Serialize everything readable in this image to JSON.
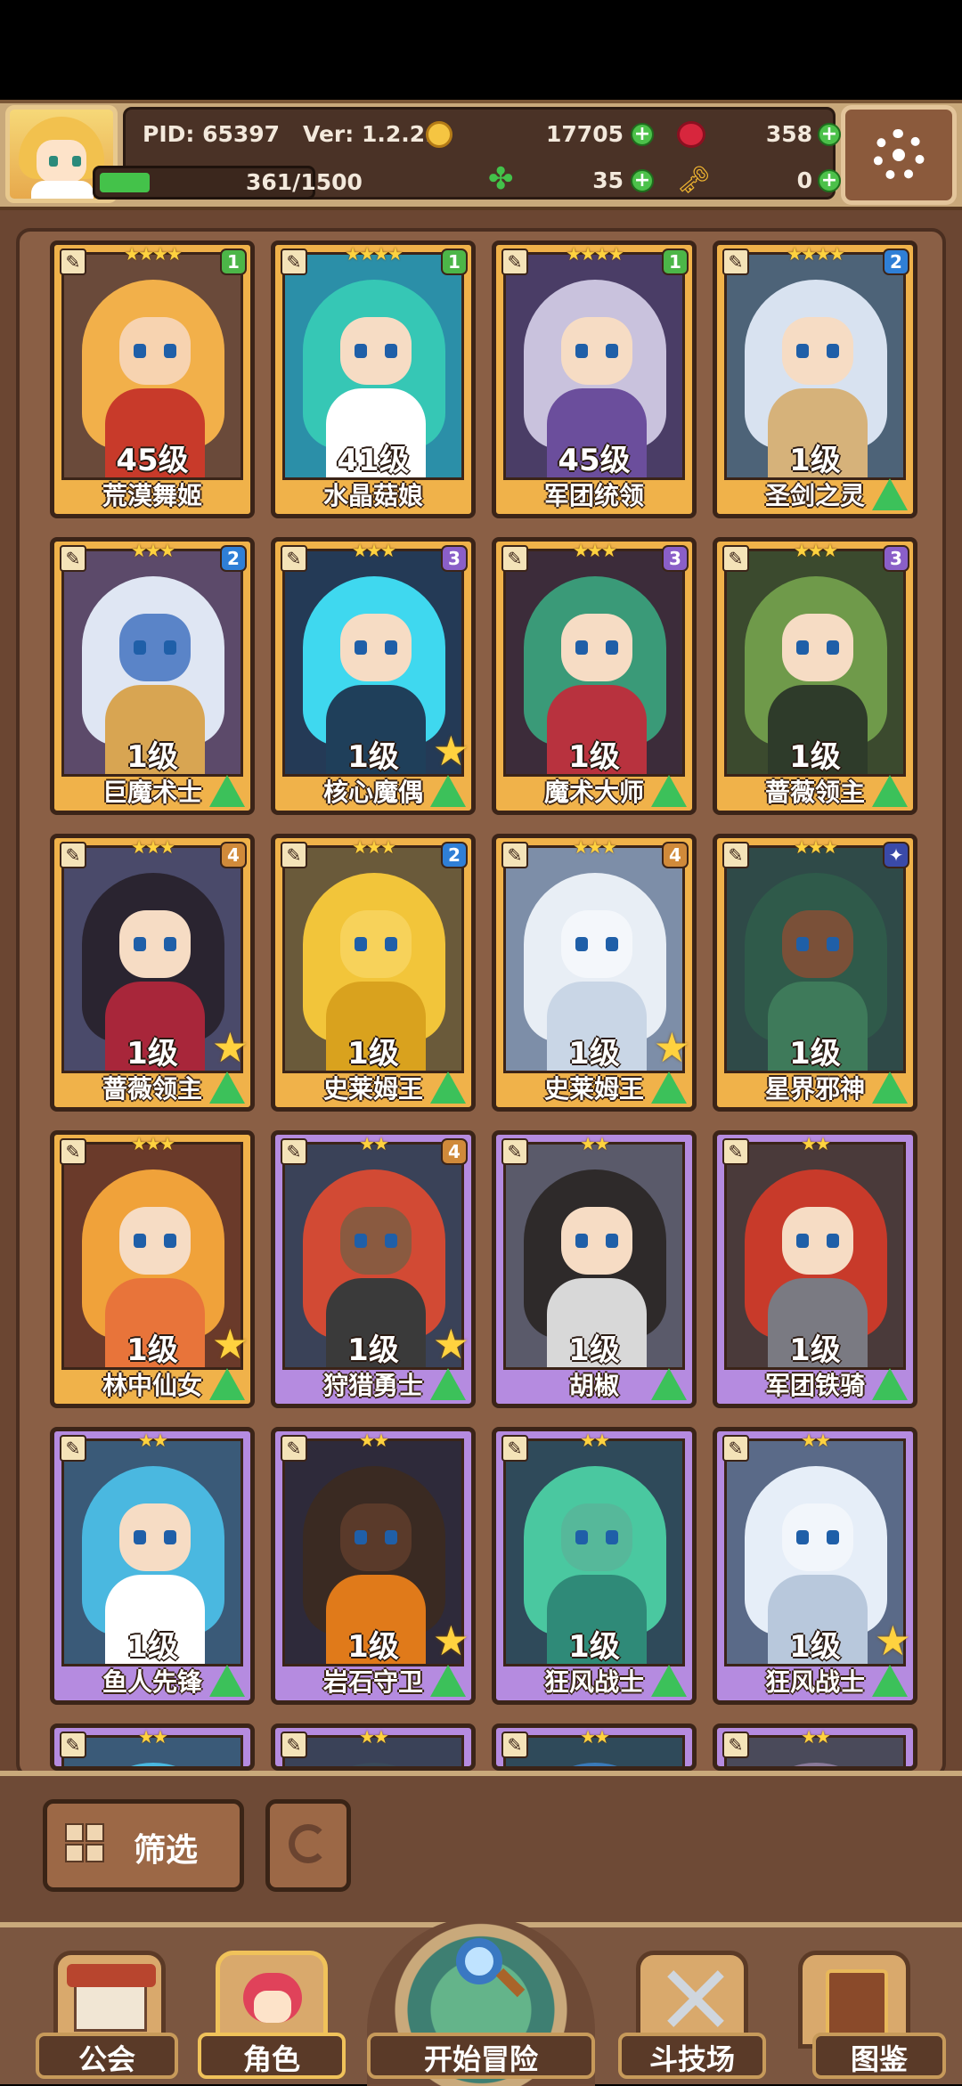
{
  "header": {
    "pid": "PID: 65397",
    "version": "Ver: 1.2.2.0",
    "gold": "17705",
    "gems": "358",
    "energy": "361/1500",
    "energy_fraction": 0.2407,
    "clovers": "35",
    "keys": "0",
    "plus": "+"
  },
  "cards": [
    {
      "name": "荒漠舞姬",
      "level": "45级",
      "stars": "★★★★",
      "badge": "1",
      "badge_color": "#4cb648",
      "frame": "gold",
      "hair": "#f2b04a",
      "skin": "#f7d3b0",
      "outfit": "#c83a2a",
      "bg": "#6a4a3a",
      "show_star": false,
      "show_tree": false
    },
    {
      "name": "水晶菇娘",
      "level": "41级",
      "stars": "★★★★",
      "badge": "1",
      "badge_color": "#4cb648",
      "frame": "gold",
      "hair": "#36c7b5",
      "skin": "#f6dcc4",
      "outfit": "#ffffff",
      "bg": "#2b8fa8",
      "show_star": false,
      "show_tree": false
    },
    {
      "name": "军团统领",
      "level": "45级",
      "stars": "★★★★",
      "badge": "1",
      "badge_color": "#4cb648",
      "frame": "gold",
      "hair": "#c9c2dd",
      "skin": "#f6dcc4",
      "outfit": "#6b4e9c",
      "bg": "#4a3d66",
      "show_star": false,
      "show_tree": false
    },
    {
      "name": "圣剑之灵",
      "level": "1级",
      "stars": "★★★★",
      "badge": "2",
      "badge_color": "#2f7fd6",
      "frame": "gold",
      "hair": "#d8e2f0",
      "skin": "#f6dcc4",
      "outfit": "#d6b27a",
      "bg": "#4d6378",
      "show_star": false,
      "show_tree": true
    },
    {
      "name": "巨魔术士",
      "level": "1级",
      "stars": "★★★",
      "badge": "2",
      "badge_color": "#2f7fd6",
      "frame": "gold",
      "hair": "#dfe6f3",
      "skin": "#5a84c8",
      "outfit": "#d8a552",
      "bg": "#5c4a6a",
      "show_star": false,
      "show_tree": true
    },
    {
      "name": "核心魔偶",
      "level": "1级",
      "stars": "★★★",
      "badge": "3",
      "badge_color": "#8a5fc8",
      "frame": "gold",
      "hair": "#3fd8ef",
      "skin": "#f6dcc4",
      "outfit": "#1f3f5a",
      "bg": "#243a56",
      "show_star": true,
      "show_tree": true
    },
    {
      "name": "魔术大师",
      "level": "1级",
      "stars": "★★★",
      "badge": "3",
      "badge_color": "#8a5fc8",
      "frame": "gold",
      "hair": "#3a9a78",
      "skin": "#f6dcc4",
      "outfit": "#b8323e",
      "bg": "#3c2c3a",
      "show_star": false,
      "show_tree": true
    },
    {
      "name": "蔷薇领主",
      "level": "1级",
      "stars": "★★★",
      "badge": "3",
      "badge_color": "#8a5fc8",
      "frame": "gold",
      "hair": "#6f9a4a",
      "skin": "#f6dcc4",
      "outfit": "#2e3b2a",
      "bg": "#3b4a2e",
      "show_star": false,
      "show_tree": true
    },
    {
      "name": "蔷薇领主",
      "level": "1级",
      "stars": "★★★",
      "badge": "4",
      "badge_color": "#d08a3a",
      "frame": "gold",
      "hair": "#2a2430",
      "skin": "#f6dcc4",
      "outfit": "#a8263a",
      "bg": "#4a4a6a",
      "show_star": true,
      "show_tree": true
    },
    {
      "name": "史莱姆王",
      "level": "1级",
      "stars": "★★★",
      "badge": "2",
      "badge_color": "#2f7fd6",
      "frame": "gold",
      "hair": "#f2c53a",
      "skin": "#f7d25a",
      "outfit": "#d9a21e",
      "bg": "#6a5a3a",
      "show_star": false,
      "show_tree": true
    },
    {
      "name": "史莱姆王",
      "level": "1级",
      "stars": "★★★",
      "badge": "4",
      "badge_color": "#d08a3a",
      "frame": "gold",
      "hair": "#e8eef5",
      "skin": "#f4f7fb",
      "outfit": "#c9d6e6",
      "bg": "#7d8ea8",
      "show_star": true,
      "show_tree": true
    },
    {
      "name": "星界邪神",
      "level": "1级",
      "stars": "★★★",
      "badge": "✦",
      "badge_color": "#3a4aa8",
      "frame": "gold",
      "hair": "#2f5a4a",
      "skin": "#7a5038",
      "outfit": "#3e7a5a",
      "bg": "#2f4a48",
      "show_star": false,
      "show_tree": true
    },
    {
      "name": "林中仙女",
      "level": "1级",
      "stars": "★★★",
      "badge": "",
      "badge_color": "",
      "frame": "gold",
      "hair": "#f0a23a",
      "skin": "#f6dcc4",
      "outfit": "#e8743a",
      "bg": "#6a3a2a",
      "show_star": true,
      "show_tree": true
    },
    {
      "name": "狩猎勇士",
      "level": "1级",
      "stars": "★★",
      "badge": "4",
      "badge_color": "#d08a3a",
      "frame": "purple",
      "hair": "#d24a34",
      "skin": "#8a5a40",
      "outfit": "#3a3a3a",
      "bg": "#3a4258",
      "show_star": true,
      "show_tree": true
    },
    {
      "name": "胡椒",
      "level": "1级",
      "stars": "★★",
      "badge": "",
      "badge_color": "",
      "frame": "purple",
      "hair": "#2e2a2a",
      "skin": "#f6dcc4",
      "outfit": "#d8d8d8",
      "bg": "#5a5a6a",
      "show_star": false,
      "show_tree": true
    },
    {
      "name": "军团铁骑",
      "level": "1级",
      "stars": "★★",
      "badge": "",
      "badge_color": "",
      "frame": "purple",
      "hair": "#c83a2a",
      "skin": "#f6dcc4",
      "outfit": "#7a7a82",
      "bg": "#4a3a3a",
      "show_star": false,
      "show_tree": true
    },
    {
      "name": "鱼人先锋",
      "level": "1级",
      "stars": "★★",
      "badge": "",
      "badge_color": "",
      "frame": "purple",
      "hair": "#4ab8e0",
      "skin": "#f6dcc4",
      "outfit": "#ffffff",
      "bg": "#3a5a78",
      "show_star": false,
      "show_tree": true
    },
    {
      "name": "岩石守卫",
      "level": "1级",
      "stars": "★★",
      "badge": "",
      "badge_color": "",
      "frame": "purple",
      "hair": "#3a2a22",
      "skin": "#5a3a2a",
      "outfit": "#e07a1a",
      "bg": "#2e2a3a",
      "show_star": true,
      "show_tree": true
    },
    {
      "name": "狂风战士",
      "level": "1级",
      "stars": "★★",
      "badge": "",
      "badge_color": "",
      "frame": "purple",
      "hair": "#4ac8a0",
      "skin": "#56b89a",
      "outfit": "#2f8a78",
      "bg": "#2f4a5a",
      "show_star": false,
      "show_tree": true
    },
    {
      "name": "狂风战士",
      "level": "1级",
      "stars": "★★",
      "badge": "",
      "badge_color": "",
      "frame": "purple",
      "hair": "#e6eef8",
      "skin": "#f2f6fb",
      "outfit": "#b8c8dc",
      "bg": "#5a6a88",
      "show_star": true,
      "show_tree": true
    },
    {
      "name": "",
      "level": "",
      "stars": "★★",
      "badge": "",
      "badge_color": "",
      "frame": "purple",
      "hair": "#4ab8e0",
      "skin": "#f6dcc4",
      "outfit": "#3a5a78",
      "bg": "#3a5a78",
      "show_star": false,
      "show_tree": false
    },
    {
      "name": "",
      "level": "",
      "stars": "★★",
      "badge": "",
      "badge_color": "",
      "frame": "purple",
      "hair": "#3a4a5a",
      "skin": "#f6dcc4",
      "outfit": "#3a4a5a",
      "bg": "#3a4258",
      "show_star": false,
      "show_tree": false
    },
    {
      "name": "",
      "level": "",
      "stars": "★★",
      "badge": "",
      "badge_color": "",
      "frame": "purple",
      "hair": "#3a7ab8",
      "skin": "#f6dcc4",
      "outfit": "#3a5a78",
      "bg": "#2f4a5a",
      "show_star": false,
      "show_tree": false
    },
    {
      "name": "",
      "level": "",
      "stars": "★★",
      "badge": "",
      "badge_color": "",
      "frame": "purple",
      "hair": "#8a7a9a",
      "skin": "#f6dcc4",
      "outfit": "#5a5a6a",
      "bg": "#4a4a5a",
      "show_star": false,
      "show_tree": false
    }
  ],
  "toolbar": {
    "filter_label": "筛选"
  },
  "nav": {
    "guild": "公会",
    "characters": "角色",
    "start_adventure": "开始冒险",
    "arena": "斗技场",
    "codex": "图鉴"
  },
  "icons": {
    "settings": "gear-icon",
    "gold": "coin-icon",
    "gems": "gem-icon",
    "energy": "clover-icon",
    "keys": "key-icon",
    "filter": "grid-icon",
    "refresh": "refresh-icon",
    "star": "star-icon",
    "upgrade": "tree-icon"
  }
}
